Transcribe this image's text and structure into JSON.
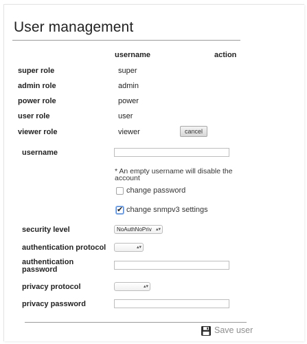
{
  "page": {
    "title": "User management"
  },
  "table": {
    "headers": {
      "username": "username",
      "action": "action"
    },
    "rows": [
      {
        "role": "super role",
        "username": "super"
      },
      {
        "role": "admin role",
        "username": "admin"
      },
      {
        "role": "power role",
        "username": "power"
      },
      {
        "role": "user role",
        "username": "user"
      },
      {
        "role": "viewer role",
        "username": "viewer",
        "action": "cancel"
      }
    ]
  },
  "form": {
    "username_label": "username",
    "username_value": "",
    "empty_note": "* An empty username will disable the account",
    "change_password_label": "change password",
    "change_password_checked": false,
    "change_snmpv3_label": "change snmpv3 settings",
    "change_snmpv3_checked": true,
    "security_level_label": "security level",
    "security_level_value": "NoAuthNoPriv",
    "auth_protocol_label": "authentication protocol",
    "auth_protocol_value": "",
    "auth_password_label": "authentication password",
    "auth_password_value": "",
    "privacy_protocol_label": "privacy protocol",
    "privacy_protocol_value": "",
    "privacy_password_label": "privacy password",
    "privacy_password_value": ""
  },
  "footer": {
    "save_label": "Save user",
    "save_icon": "floppy-disk-icon"
  }
}
